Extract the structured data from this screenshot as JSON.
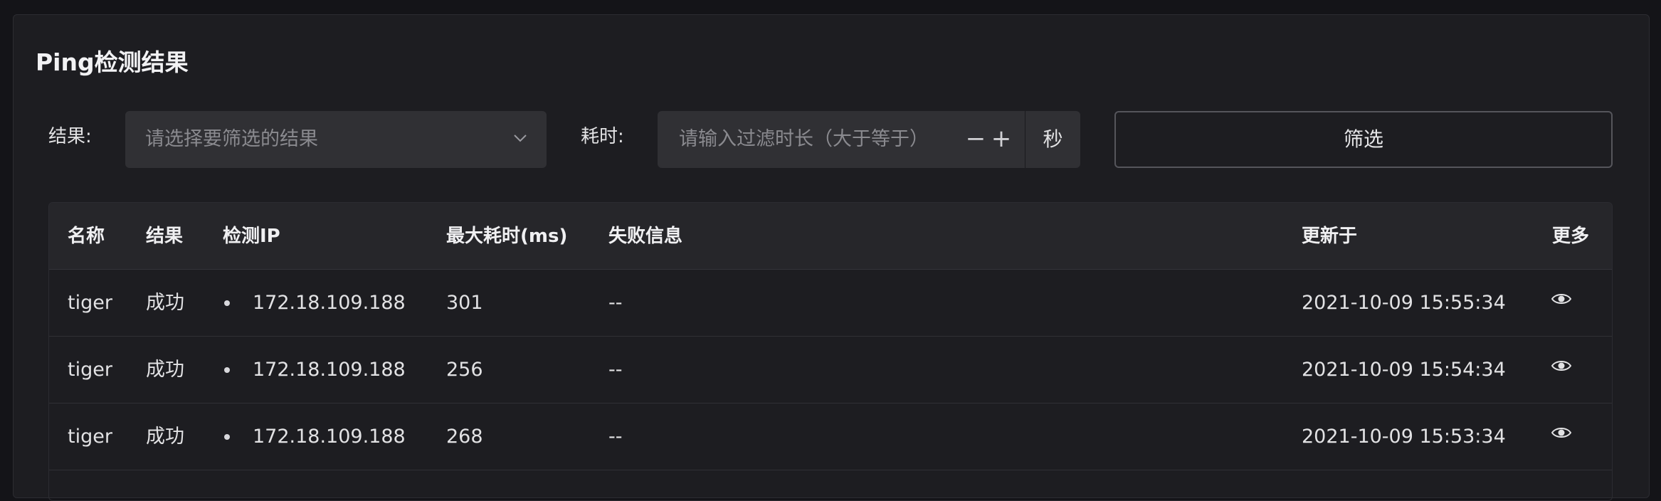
{
  "title": "Ping检测结果",
  "filters": {
    "result_label": "结果:",
    "result_placeholder": "请选择要筛选的结果",
    "duration_label": "耗时:",
    "duration_placeholder": "请输入过滤时长（大于等于）",
    "minus": "−",
    "plus": "+",
    "unit": "秒",
    "filter_button": "筛选"
  },
  "table": {
    "columns": [
      "名称",
      "结果",
      "检测IP",
      "最大耗时(ms)",
      "失败信息",
      "更新于",
      "更多"
    ],
    "rows": [
      {
        "name": "tiger",
        "result": "成功",
        "ip": "172.18.109.188",
        "max_time": "301",
        "error": "--",
        "updated": "2021-10-09 15:55:34",
        "more_icon": "eye-icon"
      },
      {
        "name": "tiger",
        "result": "成功",
        "ip": "172.18.109.188",
        "max_time": "256",
        "error": "--",
        "updated": "2021-10-09 15:54:34",
        "more_icon": "eye-icon"
      },
      {
        "name": "tiger",
        "result": "成功",
        "ip": "172.18.109.188",
        "max_time": "268",
        "error": "--",
        "updated": "2021-10-09 15:53:34",
        "more_icon": "eye-icon"
      }
    ]
  }
}
